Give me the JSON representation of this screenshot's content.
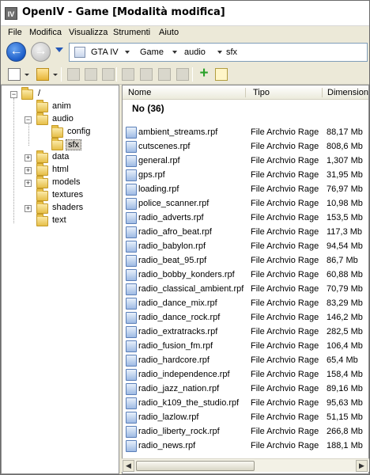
{
  "window": {
    "title": "OpenIV - Game [Modalità modifica]",
    "icon_text": "IV"
  },
  "menu": [
    "File",
    "Modifica",
    "Visualizza",
    "Strumenti",
    "Aiuto"
  ],
  "address": {
    "crumbs": [
      "GTA IV",
      "Game",
      "audio",
      "sfx"
    ]
  },
  "tree": {
    "root": "/",
    "items": [
      "anim",
      "audio",
      "config",
      "sfx",
      "data",
      "html",
      "models",
      "textures",
      "shaders",
      "text"
    ]
  },
  "list": {
    "columns": [
      "Nome",
      "Tipo",
      "Dimensione"
    ],
    "group": "No (36)",
    "files": [
      {
        "name": "ambient_streams.rpf",
        "type": "File Archvio Rage",
        "size": "88,17 Mb"
      },
      {
        "name": "cutscenes.rpf",
        "type": "File Archvio Rage",
        "size": "808,6 Mb"
      },
      {
        "name": "general.rpf",
        "type": "File Archvio Rage",
        "size": "1,307 Mb"
      },
      {
        "name": "gps.rpf",
        "type": "File Archvio Rage",
        "size": "31,95 Mb"
      },
      {
        "name": "loading.rpf",
        "type": "File Archvio Rage",
        "size": "76,97 Mb"
      },
      {
        "name": "police_scanner.rpf",
        "type": "File Archvio Rage",
        "size": "10,98 Mb"
      },
      {
        "name": "radio_adverts.rpf",
        "type": "File Archvio Rage",
        "size": "153,5 Mb"
      },
      {
        "name": "radio_afro_beat.rpf",
        "type": "File Archvio Rage",
        "size": "117,3 Mb"
      },
      {
        "name": "radio_babylon.rpf",
        "type": "File Archvio Rage",
        "size": "94,54 Mb"
      },
      {
        "name": "radio_beat_95.rpf",
        "type": "File Archvio Rage",
        "size": "86,7 Mb"
      },
      {
        "name": "radio_bobby_konders.rpf",
        "type": "File Archvio Rage",
        "size": "60,88 Mb"
      },
      {
        "name": "radio_classical_ambient.rpf",
        "type": "File Archvio Rage",
        "size": "70,79 Mb"
      },
      {
        "name": "radio_dance_mix.rpf",
        "type": "File Archvio Rage",
        "size": "83,29 Mb"
      },
      {
        "name": "radio_dance_rock.rpf",
        "type": "File Archvio Rage",
        "size": "146,2 Mb"
      },
      {
        "name": "radio_extratracks.rpf",
        "type": "File Archvio Rage",
        "size": "282,5 Mb"
      },
      {
        "name": "radio_fusion_fm.rpf",
        "type": "File Archvio Rage",
        "size": "106,4 Mb"
      },
      {
        "name": "radio_hardcore.rpf",
        "type": "File Archvio Rage",
        "size": "65,4 Mb"
      },
      {
        "name": "radio_independence.rpf",
        "type": "File Archvio Rage",
        "size": "158,4 Mb"
      },
      {
        "name": "radio_jazz_nation.rpf",
        "type": "File Archvio Rage",
        "size": "89,16 Mb"
      },
      {
        "name": "radio_k109_the_studio.rpf",
        "type": "File Archvio Rage",
        "size": "95,63 Mb"
      },
      {
        "name": "radio_lazlow.rpf",
        "type": "File Archvio Rage",
        "size": "51,15 Mb"
      },
      {
        "name": "radio_liberty_rock.rpf",
        "type": "File Archvio Rage",
        "size": "266,8 Mb"
      },
      {
        "name": "radio_news.rpf",
        "type": "File Archvio Rage",
        "size": "188,1 Mb"
      }
    ]
  }
}
